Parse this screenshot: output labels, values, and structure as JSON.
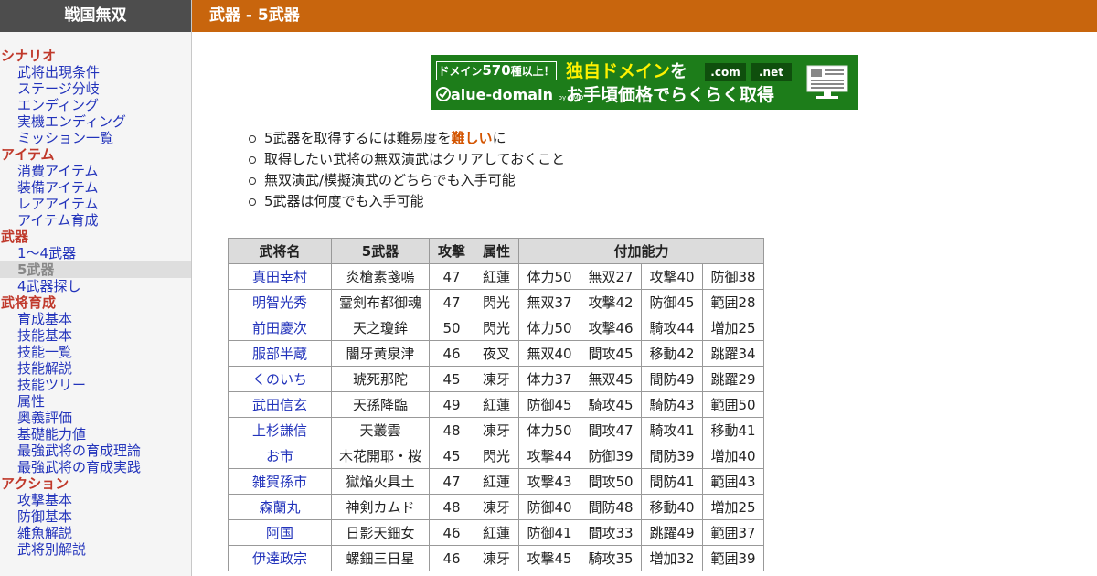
{
  "site": {
    "title": "戦国無双"
  },
  "header": {
    "title": "武器 - 5武器"
  },
  "sidebar": {
    "groups": [
      {
        "label": "シナリオ",
        "items": [
          "武将出現条件",
          "ステージ分岐",
          "エンディング",
          "実機エンディング",
          "ミッション一覧"
        ]
      },
      {
        "label": "アイテム",
        "items": [
          "消費アイテム",
          "装備アイテム",
          "レアアイテム",
          "アイテム育成"
        ]
      },
      {
        "label": "武器",
        "items": [
          "1～4武器",
          "5武器",
          "4武器探し"
        ]
      },
      {
        "label": "武将育成",
        "items": [
          "育成基本",
          "技能基本",
          "技能一覧",
          "技能解説",
          "技能ツリー",
          "属性",
          "奥義評価",
          "基礎能力値",
          "最強武将の育成理論",
          "最強武将の育成実践"
        ]
      },
      {
        "label": "アクション",
        "items": [
          "攻撃基本",
          "防御基本",
          "雑魚解説",
          "武将別解説"
        ]
      }
    ],
    "active_item": "5武器"
  },
  "banner": {
    "tag_pre": "ドメイン",
    "tag_num": "570",
    "tag_post": "種以上！",
    "line1_yellow": "独自ドメイン",
    "line1_rest": "を",
    "tld1": ".com",
    "tld2": ".net",
    "line2": "お手頃価格でらくらく取得",
    "logo": "alue-domain",
    "logo_suffix": "by GMO",
    "check_icon": "check-v-icon",
    "monitor_icon": "monitor-icon"
  },
  "notes": {
    "n1_pre": "5武器を取得するには難易度を",
    "n1_red": "難しい",
    "n1_post": "に",
    "n2": "取得したい武将の無双演武はクリアしておくこと",
    "n3": "無双演武/模擬演武のどちらでも入手可能",
    "n4": "5武器は何度でも入手可能"
  },
  "table": {
    "headers": [
      "武将名",
      "5武器",
      "攻撃",
      "属性",
      "付加能力"
    ],
    "rows": [
      [
        "真田幸村",
        "炎槍素戔嗚",
        "47",
        "紅蓮",
        "体力50",
        "無双27",
        "攻撃40",
        "防御38"
      ],
      [
        "明智光秀",
        "霊剣布都御魂",
        "47",
        "閃光",
        "無双37",
        "攻撃42",
        "防御45",
        "範囲28"
      ],
      [
        "前田慶次",
        "天之瓊鉾",
        "50",
        "閃光",
        "体力50",
        "攻撃46",
        "騎攻44",
        "増加25"
      ],
      [
        "服部半蔵",
        "闇牙黄泉津",
        "46",
        "夜叉",
        "無双40",
        "間攻45",
        "移動42",
        "跳躍34"
      ],
      [
        "くのいち",
        "琥死那陀",
        "45",
        "凍牙",
        "体力37",
        "無双45",
        "間防49",
        "跳躍29"
      ],
      [
        "武田信玄",
        "天孫降臨",
        "49",
        "紅蓮",
        "防御45",
        "騎攻45",
        "騎防43",
        "範囲50"
      ],
      [
        "上杉謙信",
        "天叢雲",
        "48",
        "凍牙",
        "体力50",
        "間攻47",
        "騎攻41",
        "移動41"
      ],
      [
        "お市",
        "木花開耶・桜",
        "45",
        "閃光",
        "攻撃44",
        "防御39",
        "間防39",
        "増加40"
      ],
      [
        "雑賀孫市",
        "獄焔火具土",
        "47",
        "紅蓮",
        "攻撃43",
        "間攻50",
        "間防41",
        "範囲43"
      ],
      [
        "森蘭丸",
        "神剣カムド",
        "48",
        "凍牙",
        "防御40",
        "間防48",
        "移動40",
        "増加25"
      ],
      [
        "阿国",
        "日影天鈿女",
        "46",
        "紅蓮",
        "防御41",
        "間攻33",
        "跳躍49",
        "範囲37"
      ],
      [
        "伊達政宗",
        "螺鈿三日星",
        "46",
        "凍牙",
        "攻撃45",
        "騎攻35",
        "増加32",
        "範囲39"
      ]
    ]
  }
}
